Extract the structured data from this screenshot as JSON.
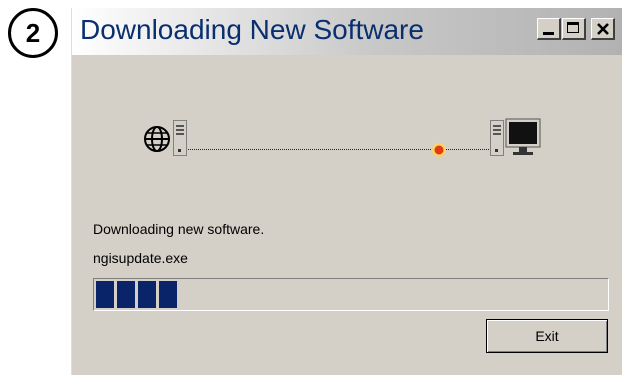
{
  "step": {
    "number": "2"
  },
  "window": {
    "title": "Downloading New Software",
    "controls": {
      "minimize_icon": "minimize-icon",
      "maximize_icon": "maximize-icon",
      "close_icon": "close-icon"
    }
  },
  "animation": {
    "source_icon": "globe-icon",
    "source_server_icon": "server-icon",
    "packet_icon": "data-packet-icon",
    "target_server_icon": "server-icon",
    "target_computer_icon": "monitor-icon"
  },
  "status": {
    "message": "Downloading new software.",
    "filename": "ngisupdate.exe"
  },
  "progress": {
    "fraction": 0.18,
    "blocks_filled": 4
  },
  "buttons": {
    "exit_label": "Exit"
  },
  "colors": {
    "window_bg": "#d4d0c8",
    "title_text": "#0a2f6e",
    "progress_block": "#0a246a",
    "packet": "#f28a1a"
  }
}
